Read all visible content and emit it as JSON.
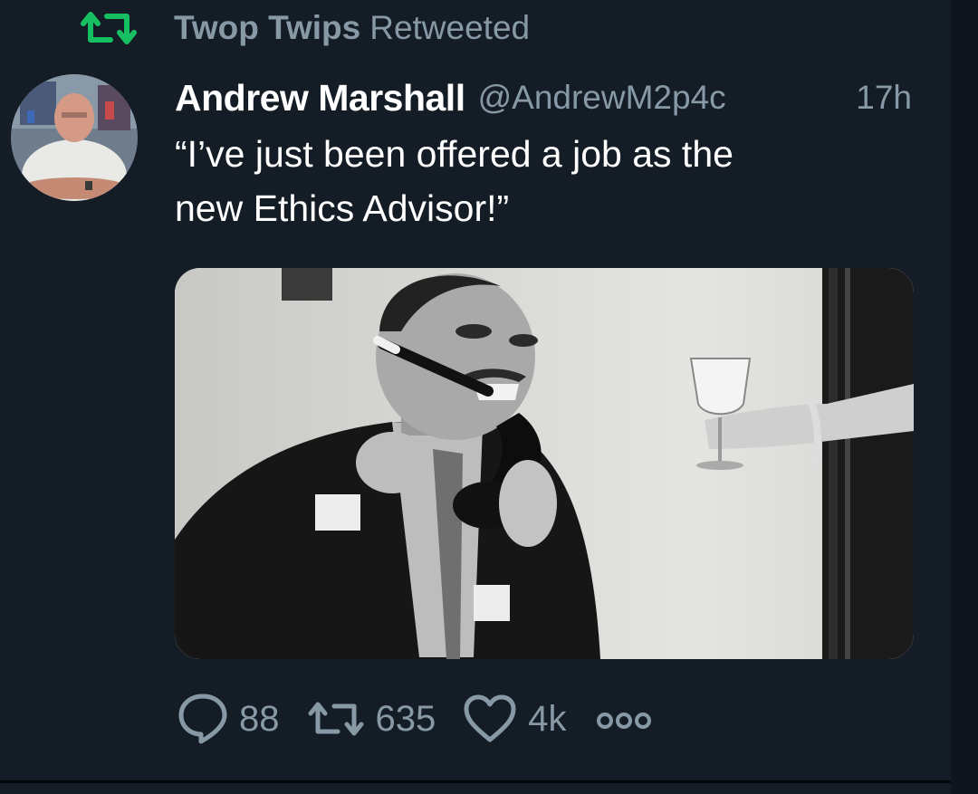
{
  "retweet_context": {
    "user": "Twop Twips",
    "label": "Retweeted",
    "icon": "retweet-icon"
  },
  "tweet": {
    "author_name": "Andrew Marshall",
    "author_handle": "@AndrewM2p4c",
    "time": "17h",
    "text_line1": "“I’ve just been offered a job as the",
    "text_line2": "new Ethics Advisor!”",
    "avatar": "avatar-photo",
    "media": "black-and-white-photo-man-on-telephone"
  },
  "actions": {
    "reply_count": "88",
    "retweet_count": "635",
    "like_count": "4k",
    "reply_icon": "reply-icon",
    "retweet_icon": "retweet-icon",
    "like_icon": "heart-icon",
    "more_icon": "more-icon"
  },
  "colors": {
    "background": "#141d26",
    "secondary_text": "#8899a6",
    "retweet_green": "#17bf63",
    "text": "#ffffff"
  }
}
